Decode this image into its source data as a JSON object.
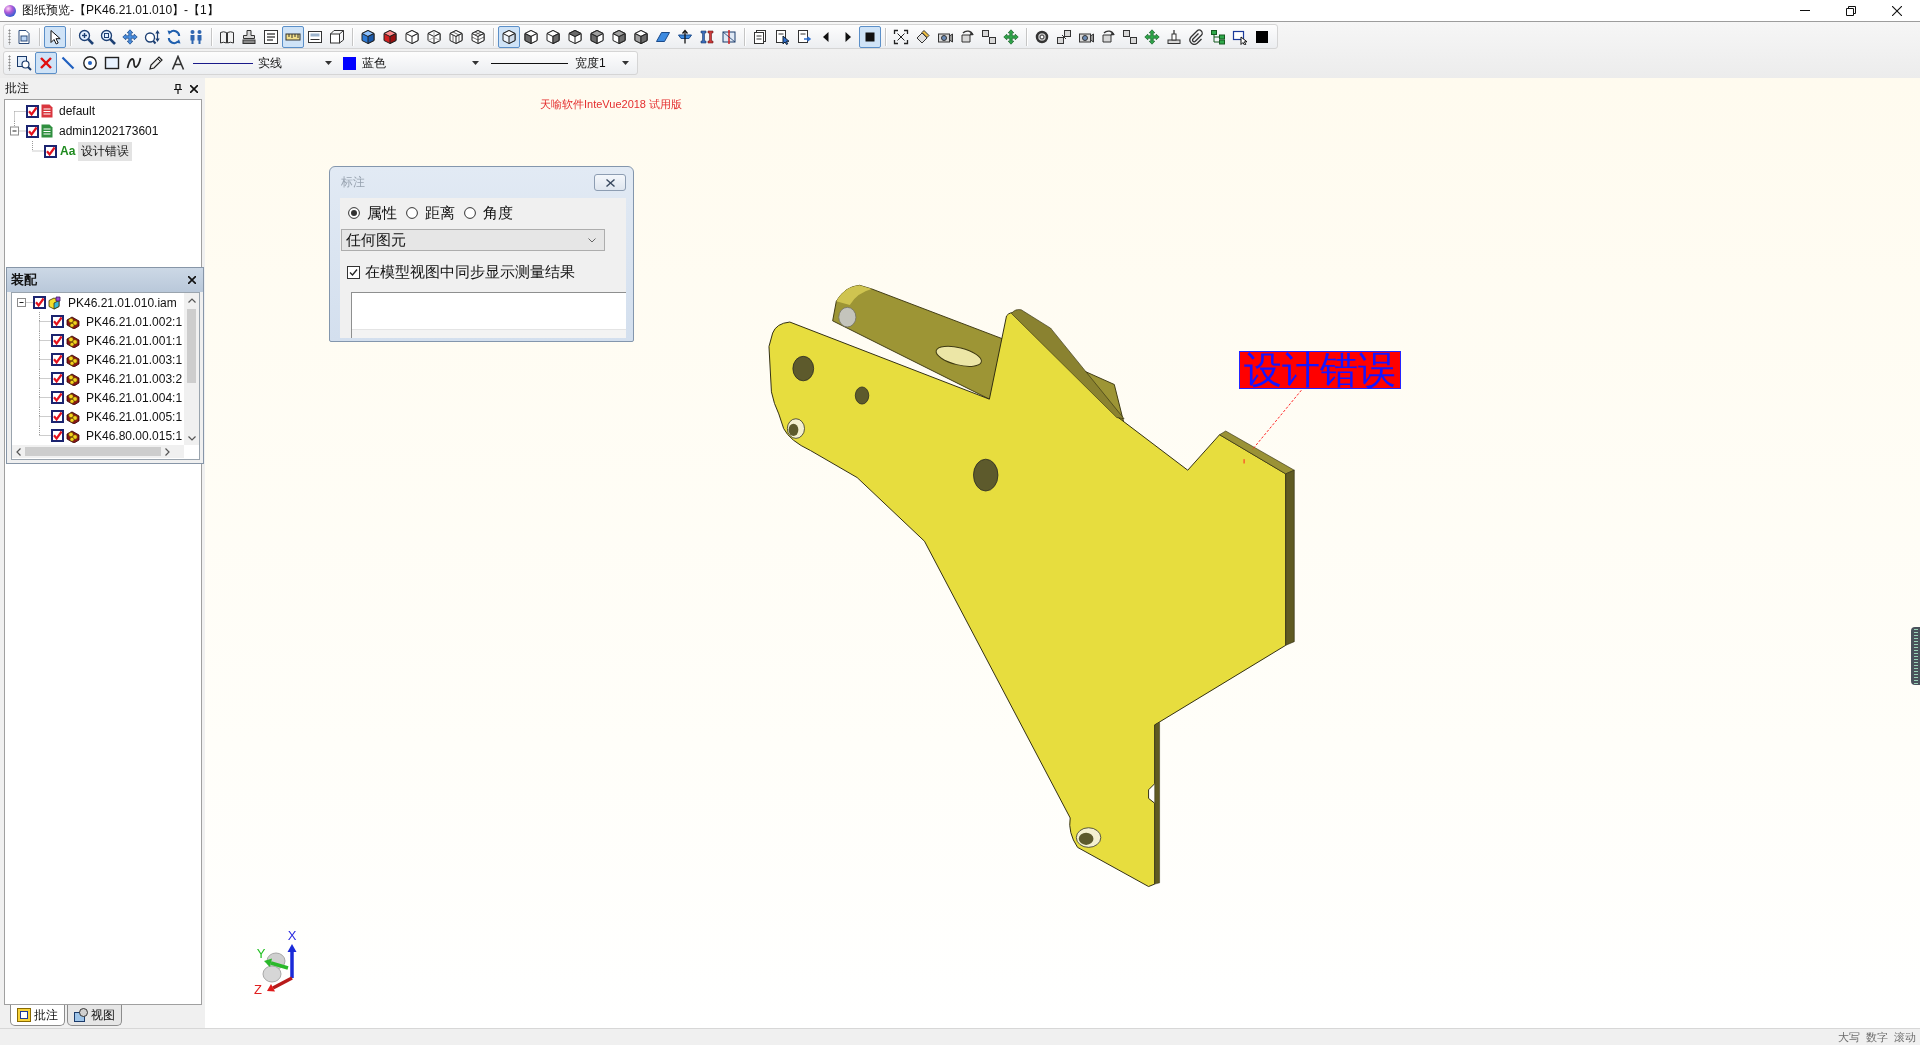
{
  "window": {
    "title": "图纸预览-【PK46.21.01.010】-【1】"
  },
  "toolbars": [
    {
      "groups": [
        [
          {
            "pressed": false
          }
        ],
        [
          {
            "pressed": true
          }
        ],
        [
          {
            "pressed": false
          },
          {
            "pressed": false
          },
          {
            "pressed": false
          },
          {
            "pressed": false
          },
          {
            "pressed": false
          },
          {
            "pressed": false
          }
        ],
        [
          {
            "pressed": false
          },
          {
            "pressed": false
          },
          {
            "pressed": false
          },
          {
            "pressed": true
          },
          {
            "pressed": false
          },
          {
            "pressed": false
          }
        ],
        [
          {
            "pressed": false
          },
          {
            "pressed": false
          },
          {
            "pressed": false
          },
          {
            "pressed": false
          },
          {
            "pressed": false
          },
          {
            "pressed": false
          }
        ],
        [
          {
            "pressed": true
          },
          {
            "pressed": false
          },
          {
            "pressed": false
          },
          {
            "pressed": false
          },
          {
            "pressed": false
          },
          {
            "pressed": false
          },
          {
            "pressed": false
          },
          {
            "pressed": false
          },
          {
            "pressed": false
          },
          {
            "pressed": false
          },
          {
            "pressed": false
          }
        ],
        [
          {
            "pressed": false
          },
          {
            "pressed": false
          },
          {
            "pressed": false
          },
          {
            "pressed": false
          },
          {
            "pressed": false
          },
          {
            "pressed": true
          }
        ],
        [
          {
            "pressed": false
          },
          {
            "pressed": false
          },
          {
            "pressed": false
          },
          {
            "pressed": false
          },
          {
            "pressed": false
          },
          {
            "pressed": false
          }
        ],
        [
          {
            "pressed": false
          },
          {
            "pressed": false
          },
          {
            "pressed": false
          },
          {
            "pressed": false
          },
          {
            "pressed": false
          },
          {
            "pressed": false
          },
          {
            "pressed": false
          },
          {
            "pressed": false
          },
          {
            "pressed": false
          },
          {
            "pressed": false
          },
          {
            "pressed": false
          }
        ]
      ]
    },
    {
      "groups": [
        [
          {
            "pressed": false
          },
          {
            "pressed": true
          },
          {
            "pressed": false
          },
          {
            "pressed": false
          },
          {
            "pressed": false
          },
          {
            "pressed": false
          },
          {
            "pressed": false
          },
          {
            "pressed": false
          }
        ]
      ],
      "dropdowns": [
        {
          "kind": "line_style",
          "value": "实线"
        },
        {
          "kind": "color",
          "value": "蓝色",
          "color": "#0000ff"
        },
        {
          "kind": "line_width",
          "value": "宽度1"
        }
      ]
    }
  ],
  "annotation_panel": {
    "title": "批注",
    "tree": [
      {
        "label": "default",
        "checked": true,
        "selected": false,
        "color": "#d9363e"
      },
      {
        "label": "admin1202173601",
        "checked": true,
        "selected": false,
        "color": "#2f8f3f",
        "expanded": true,
        "children": [
          {
            "label": "设计错误",
            "checked": true,
            "selected": true,
            "icon_text": "Aa"
          }
        ]
      }
    ]
  },
  "assembly_panel": {
    "title": "装配",
    "tree": [
      {
        "label": "PK46.21.01.010.iam",
        "kind": "assembly",
        "checked": true,
        "selected": false,
        "expanded": true,
        "children": [
          {
            "label": "PK46.21.01.002:1",
            "kind": "part",
            "checked": true,
            "selected": false
          },
          {
            "label": "PK46.21.01.001:1",
            "kind": "part",
            "checked": true,
            "selected": false
          },
          {
            "label": "PK46.21.01.003:1",
            "kind": "part",
            "checked": true,
            "selected": false
          },
          {
            "label": "PK46.21.01.003:2",
            "kind": "part",
            "checked": true,
            "selected": false
          },
          {
            "label": "PK46.21.01.004:1",
            "kind": "part",
            "checked": true,
            "selected": false
          },
          {
            "label": "PK46.21.01.005:1",
            "kind": "part",
            "checked": true,
            "selected": false
          },
          {
            "label": "PK46.80.00.015:1",
            "kind": "part",
            "checked": true,
            "selected": false
          }
        ]
      }
    ]
  },
  "panel_tabs": [
    {
      "label": "批注",
      "kind": "annotation",
      "selected": true
    },
    {
      "label": "视图",
      "kind": "view",
      "selected": false
    }
  ],
  "measure_dialog": {
    "title": "标注",
    "modes": [
      {
        "label": "属性",
        "selected": true
      },
      {
        "label": "距离",
        "selected": false
      },
      {
        "label": "角度",
        "selected": false
      }
    ],
    "filter": {
      "value": "任何图元"
    },
    "sync_option": {
      "label": "在模型视图中同步显示测量结果",
      "checked": true
    }
  },
  "viewport": {
    "trial_notice": "天喻软件InteVue2018 试用版",
    "annotation": {
      "text": "设计错误"
    },
    "axes": {
      "x": "X",
      "y": "Y",
      "z": "Z"
    }
  },
  "status_bar": {
    "indicators": [
      "大写",
      "数字",
      "滚动"
    ]
  }
}
